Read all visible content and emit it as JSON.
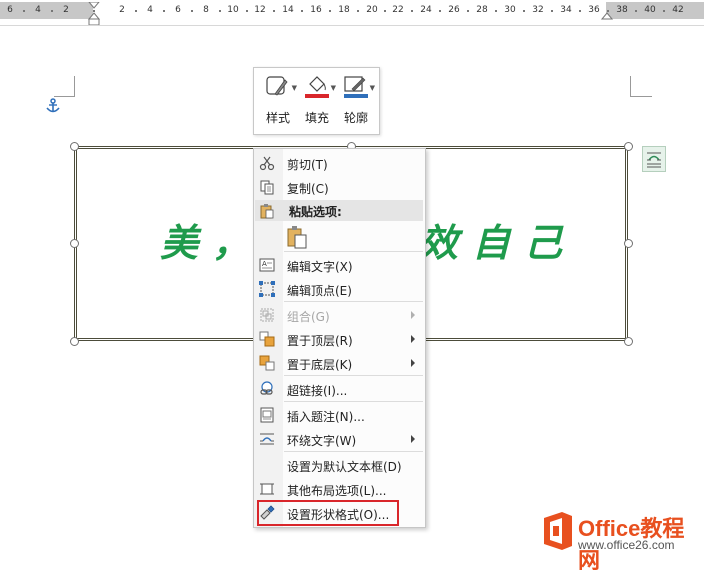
{
  "ruler": {
    "numbers": [
      "6",
      "4",
      "2",
      "2",
      "4",
      "6",
      "8",
      "10",
      "12",
      "14",
      "16",
      "18",
      "20",
      "22",
      "24",
      "26",
      "28",
      "30",
      "32",
      "34",
      "36",
      "38",
      "40",
      "42"
    ]
  },
  "mini_toolbar": {
    "style_label": "样式",
    "fill_label": "填充",
    "outline_label": "轮廓",
    "fill_color": "#d9262b",
    "outline_color": "#2f6fba"
  },
  "shape": {
    "text_left": "美，",
    "text_right": "效自己",
    "text_color": "#1f9b4c"
  },
  "context_menu": {
    "cut": "剪切(T)",
    "copy": "复制(C)",
    "paste_options": "粘贴选项:",
    "edit_text": "编辑文字(X)",
    "edit_points": "编辑顶点(E)",
    "group": "组合(G)",
    "bring_to_front": "置于顶层(R)",
    "send_to_back": "置于底层(K)",
    "hyperlink": "超链接(I)...",
    "insert_caption": "插入题注(N)...",
    "wrap_text": "环绕文字(W)",
    "set_default_textbox": "设置为默认文本框(D)",
    "more_layout_options": "其他布局选项(L)...",
    "format_shape": "设置形状格式(O)..."
  },
  "watermark": {
    "brand": "Office教程网",
    "url": "www.office26.com"
  },
  "colors": {
    "highlight": "#d9262b",
    "brand_orange": "#e8501f"
  }
}
